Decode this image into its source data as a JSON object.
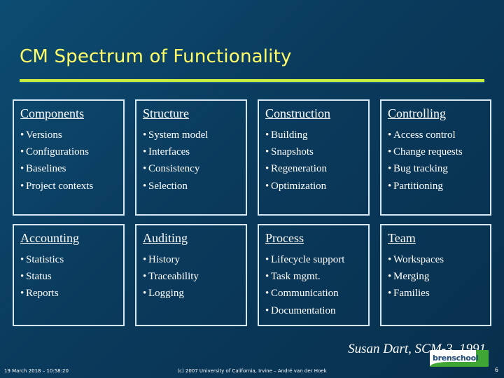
{
  "slide": {
    "title": "CM Spectrum of Functionality",
    "attribution": "Susan Dart, SCM-3, 1991",
    "cards": [
      {
        "heading": "Components",
        "items": [
          "Versions",
          "Configurations",
          "Baselines",
          "Project contexts"
        ]
      },
      {
        "heading": "Structure",
        "items": [
          "System model",
          "Interfaces",
          "Consistency",
          "Selection"
        ]
      },
      {
        "heading": "Construction",
        "items": [
          "Building",
          "Snapshots",
          "Regeneration",
          "Optimization"
        ]
      },
      {
        "heading": "Controlling",
        "items": [
          "Access control",
          "Change requests",
          "Bug tracking",
          "Partitioning"
        ]
      },
      {
        "heading": "Accounting",
        "items": [
          "Statistics",
          "Status",
          "Reports"
        ]
      },
      {
        "heading": "Auditing",
        "items": [
          "History",
          "Traceability",
          "Logging"
        ]
      },
      {
        "heading": "Process",
        "items": [
          "Lifecycle support",
          "Task mgmt.",
          "Communication",
          "Documentation"
        ]
      },
      {
        "heading": "Team",
        "items": [
          "Workspaces",
          "Merging",
          "Families"
        ]
      }
    ],
    "footer": {
      "left": "19 March 2018 – 10:58:20",
      "center": "(c) 2007 University of California, Irvine – André van der Hoek",
      "page": "6",
      "logo_text": "bren",
      "logo_text2": "school"
    },
    "colors": {
      "title": "#ffff66",
      "rule": "#c8ee3f",
      "background": "#0a3a5c",
      "card_border": "#d7e8f5"
    }
  }
}
